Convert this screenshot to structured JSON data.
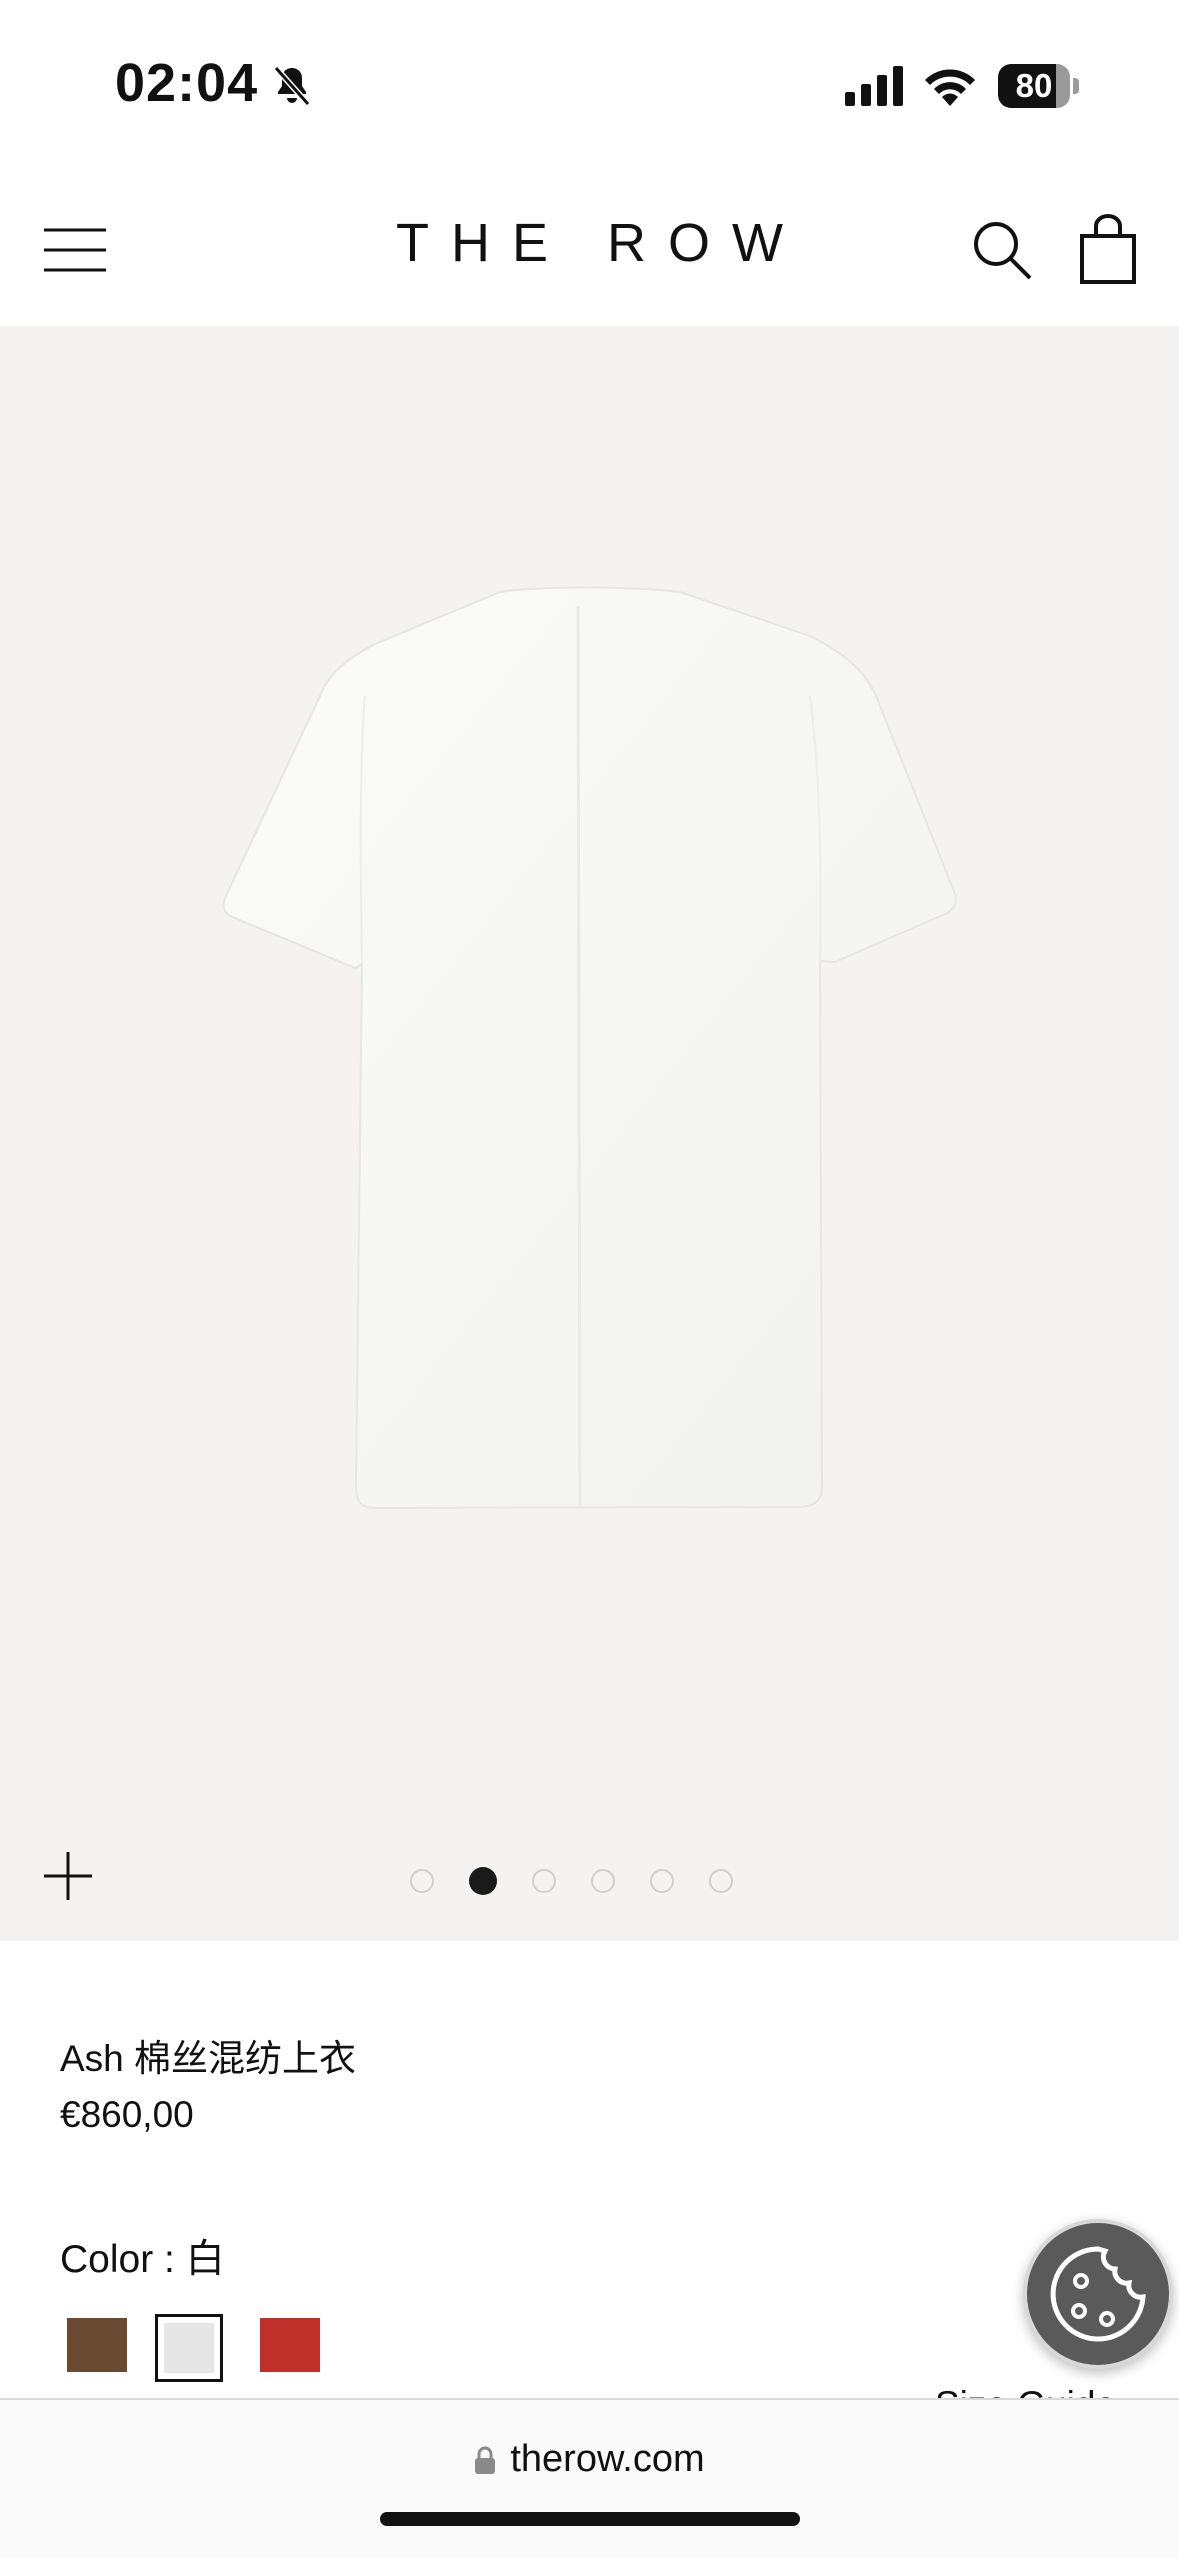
{
  "status_bar": {
    "time": "02:04",
    "battery": "80",
    "battery_level": 0.8
  },
  "header": {
    "logo": "THE ROW"
  },
  "gallery": {
    "image_alt_icon": "t-shirt-back-image",
    "dot_count": 6,
    "active_index": 1
  },
  "product": {
    "name": "Ash 棉丝混纺上衣",
    "price": "€860,00",
    "color_label": "Color : 白",
    "swatches": [
      {
        "color": "#6b4a32",
        "selected": false
      },
      {
        "color": "#e6e6e6",
        "selected": true
      },
      {
        "color": "#c0302a",
        "selected": false
      }
    ],
    "size_guide": "Size Guide"
  },
  "browser": {
    "url": "therow.com"
  },
  "colors": {
    "gallery_bg": "#f4f3f1",
    "cookie_bg": "#5a5a5a"
  }
}
